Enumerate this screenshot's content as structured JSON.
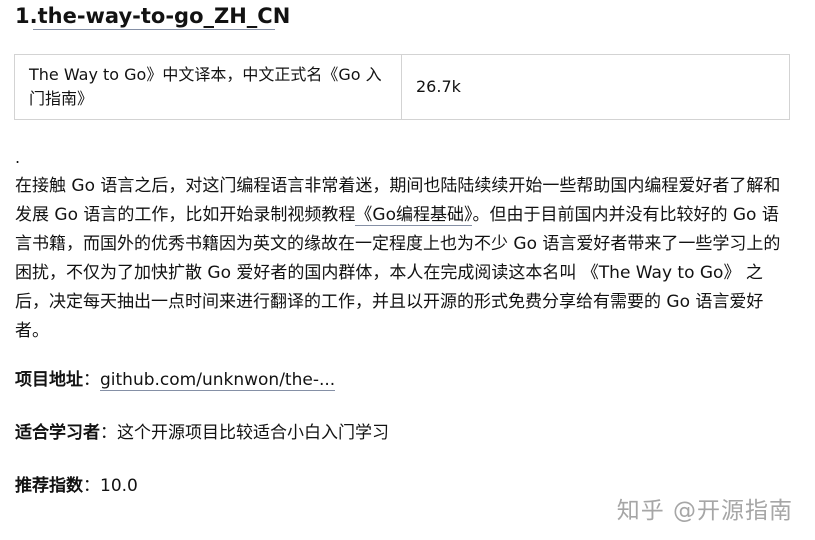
{
  "title": "1.the-way-to-go_ZH_CN",
  "table": {
    "rows": [
      {
        "description": "The Way to Go》中文译本，中文正式名《Go 入门指南》",
        "stars": "26.7k"
      }
    ]
  },
  "dot": ".",
  "paragraph": {
    "part1": "在接触 Go 语言之后，对这门编程语言非常着迷，期间也陆陆续续开始一些帮助国内编程爱好者了解和发展 Go 语言的工作，比如开始录制视频教程",
    "course": "《Go编程基础》",
    "part2": "。但由于目前国内并没有比较好的 Go 语言书籍，而国外的优秀书籍因为英文的缘故在一定程度上也为不少 Go 语言爱好者带来了一些学习上的困扰，不仅为了加快扩散 Go 爱好者的国内群体，本人在完成阅读这本名叫 《The Way to Go》 之后，决定每天抽出一点时间来进行翻译的工作，并且以开源的形式免费分享给有需要的 Go 语言爱好者。"
  },
  "project_address": {
    "label": "项目地址",
    "sep": "：",
    "value": "github.com/unknwon/the-..."
  },
  "suitable": {
    "label": "适合学习者",
    "sep": "：",
    "value": "这个开源项目比较适合小白入门学习"
  },
  "rating": {
    "label": "推荐指数",
    "sep": "：",
    "value": "10.0"
  },
  "watermark": "知乎 @开源指南"
}
